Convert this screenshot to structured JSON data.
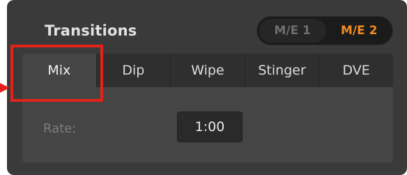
{
  "panel": {
    "title": "Transitions"
  },
  "me_toggle": {
    "options": [
      "M/E 1",
      "M/E 2"
    ],
    "active": "M/E 2"
  },
  "tabs": {
    "items": [
      "Mix",
      "Dip",
      "Wipe",
      "Stinger",
      "DVE"
    ],
    "selected": "Mix"
  },
  "rate": {
    "label": "Rate:",
    "value": "1:00"
  },
  "colors": {
    "accent_active": "#f08a24",
    "highlight_annotation": "#e2231a",
    "panel_bg": "#3a3a3a"
  },
  "icons": {
    "annotation_pointer": "arrow-right-icon"
  }
}
